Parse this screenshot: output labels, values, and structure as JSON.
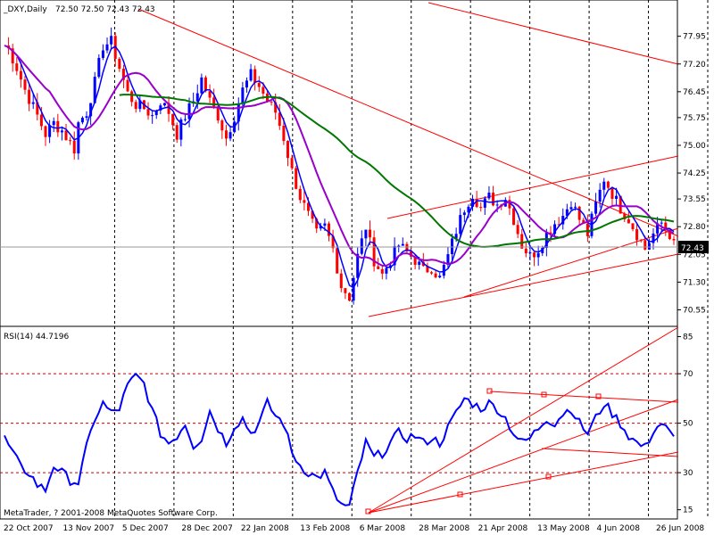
{
  "header": {
    "symbol": "_DXY,Daily",
    "ohlc": "72.50 72.50 72.43 72.43"
  },
  "price_panel": {
    "current_price": "72.43",
    "y_ticks": [
      "77.95",
      "77.20",
      "76.45",
      "75.75",
      "75.00",
      "74.25",
      "73.55",
      "72.80",
      "72.05",
      "71.30",
      "70.55"
    ]
  },
  "rsi_panel": {
    "title": "RSI(14) 44.7196",
    "y_ticks": [
      "85",
      "70",
      "50",
      "30",
      "15"
    ]
  },
  "x_ticks": [
    "22 Oct 2007",
    "13 Nov 2007",
    "5 Dec 2007",
    "28 Dec 2007",
    "22 Jan 2008",
    "13 Feb 2008",
    "6 Mar 2008",
    "28 Mar 2008",
    "21 Apr 2008",
    "13 May 2008",
    "4 Jun 2008",
    "26 Jun 2008"
  ],
  "copyright": "MetaTrader, ? 2001-2008 MetaQuotes Software Corp.",
  "colors": {
    "bull": "#0000ff",
    "bear": "#ff0000",
    "ma_fast": "#0000ff",
    "ma_mid": "#9900cc",
    "ma_slow": "#007700",
    "trendline": "#ff0000",
    "rsi": "#0000ff",
    "level_line": "#cc0000",
    "grid": "#000000"
  },
  "chart_data": [
    {
      "type": "candlestick",
      "title": "_DXY,Daily",
      "ylim": [
        70.2,
        78.4
      ],
      "x": [
        "22 Oct 2007",
        "13 Nov 2007",
        "5 Dec 2007",
        "28 Dec 2007",
        "22 Jan 2008",
        "13 Feb 2008",
        "6 Mar 2008",
        "28 Mar 2008",
        "21 Apr 2008",
        "13 May 2008",
        "4 Jun 2008",
        "26 Jun 2008"
      ],
      "close_path": [
        [
          0,
          77.7
        ],
        [
          1,
          77.6
        ],
        [
          3,
          77.1
        ],
        [
          5,
          76.5
        ],
        [
          8,
          75.8
        ],
        [
          10,
          75.3
        ],
        [
          12,
          75.6
        ],
        [
          14,
          75.4
        ],
        [
          17,
          74.9
        ],
        [
          18,
          75.6
        ],
        [
          20,
          75.9
        ],
        [
          22,
          76.7
        ],
        [
          24,
          77.7
        ],
        [
          26,
          77.8
        ],
        [
          28,
          77.1
        ],
        [
          30,
          76.4
        ],
        [
          32,
          76.1
        ],
        [
          34,
          76.0
        ],
        [
          36,
          75.8
        ],
        [
          38,
          76.2
        ],
        [
          40,
          75.9
        ],
        [
          42,
          75.3
        ],
        [
          44,
          75.8
        ],
        [
          46,
          76.2
        ],
        [
          48,
          76.8
        ],
        [
          50,
          76.2
        ],
        [
          52,
          75.8
        ],
        [
          54,
          75.2
        ],
        [
          56,
          75.8
        ],
        [
          58,
          76.5
        ],
        [
          60,
          76.9
        ],
        [
          62,
          76.6
        ],
        [
          64,
          76.2
        ],
        [
          66,
          75.9
        ],
        [
          68,
          75.2
        ],
        [
          70,
          74.3
        ],
        [
          72,
          73.6
        ],
        [
          74,
          73.1
        ],
        [
          76,
          72.6
        ],
        [
          78,
          72.8
        ],
        [
          80,
          72.2
        ],
        [
          82,
          71.2
        ],
        [
          84,
          70.9
        ],
        [
          86,
          72.0
        ],
        [
          88,
          72.8
        ],
        [
          90,
          71.9
        ],
        [
          92,
          71.5
        ],
        [
          94,
          71.9
        ],
        [
          96,
          72.3
        ],
        [
          98,
          72.1
        ],
        [
          100,
          71.9
        ],
        [
          102,
          71.6
        ],
        [
          104,
          71.7
        ],
        [
          106,
          71.4
        ],
        [
          108,
          72.0
        ],
        [
          110,
          72.7
        ],
        [
          112,
          73.3
        ],
        [
          114,
          73.7
        ],
        [
          116,
          73.3
        ],
        [
          118,
          73.6
        ],
        [
          120,
          73.4
        ],
        [
          122,
          73.6
        ],
        [
          124,
          73.0
        ],
        [
          126,
          72.3
        ],
        [
          128,
          72.0
        ],
        [
          130,
          72.2
        ],
        [
          132,
          72.6
        ],
        [
          134,
          72.9
        ],
        [
          136,
          73.1
        ],
        [
          138,
          73.5
        ],
        [
          140,
          73.0
        ],
        [
          142,
          72.6
        ],
        [
          144,
          73.4
        ],
        [
          146,
          74.1
        ],
        [
          148,
          73.7
        ],
        [
          150,
          73.3
        ],
        [
          152,
          73.0
        ],
        [
          154,
          72.6
        ],
        [
          156,
          72.2
        ],
        [
          158,
          72.6
        ],
        [
          160,
          72.9
        ],
        [
          162,
          72.6
        ],
        [
          163,
          72.43
        ]
      ],
      "moving_averages": [
        {
          "name": "MA fast",
          "color": "#0000ff"
        },
        {
          "name": "MA mid",
          "color": "#9900cc"
        },
        {
          "name": "MA slow",
          "color": "#007700"
        }
      ]
    },
    {
      "type": "line",
      "title": "RSI(14) 44.7196",
      "ylim": [
        12,
        87
      ],
      "levels": [
        70,
        50,
        30
      ],
      "series": [
        {
          "values": [
            [
              0,
              44
            ],
            [
              2,
              38
            ],
            [
              4,
              32
            ],
            [
              6,
              30
            ],
            [
              8,
              25
            ],
            [
              10,
              23
            ],
            [
              12,
              33
            ],
            [
              14,
              30
            ],
            [
              16,
              27
            ],
            [
              18,
              26
            ],
            [
              20,
              40
            ],
            [
              22,
              52
            ],
            [
              24,
              58
            ],
            [
              26,
              54
            ],
            [
              28,
              56
            ],
            [
              30,
              65
            ],
            [
              32,
              69
            ],
            [
              34,
              66
            ],
            [
              36,
              55
            ],
            [
              38,
              46
            ],
            [
              40,
              42
            ],
            [
              42,
              45
            ],
            [
              44,
              50
            ],
            [
              46,
              41
            ],
            [
              48,
              44
            ],
            [
              50,
              55
            ],
            [
              52,
              48
            ],
            [
              54,
              42
            ],
            [
              56,
              49
            ],
            [
              58,
              52
            ],
            [
              60,
              46
            ],
            [
              62,
              50
            ],
            [
              64,
              58
            ],
            [
              66,
              53
            ],
            [
              68,
              50
            ],
            [
              70,
              38
            ],
            [
              72,
              33
            ],
            [
              74,
              30
            ],
            [
              76,
              28
            ],
            [
              78,
              30
            ],
            [
              80,
              22
            ],
            [
              82,
              17
            ],
            [
              84,
              16
            ],
            [
              86,
              30
            ],
            [
              88,
              42
            ],
            [
              90,
              36
            ],
            [
              92,
              38
            ],
            [
              94,
              42
            ],
            [
              96,
              46
            ],
            [
              98,
              44
            ],
            [
              100,
              45
            ],
            [
              102,
              42
            ],
            [
              104,
              44
            ],
            [
              106,
              42
            ],
            [
              108,
              48
            ],
            [
              110,
              54
            ],
            [
              112,
              60
            ],
            [
              114,
              58
            ],
            [
              116,
              56
            ],
            [
              118,
              58
            ],
            [
              120,
              56
            ],
            [
              122,
              52
            ],
            [
              124,
              46
            ],
            [
              126,
              42
            ],
            [
              128,
              44
            ],
            [
              130,
              48
            ],
            [
              132,
              52
            ],
            [
              134,
              50
            ],
            [
              136,
              54
            ],
            [
              138,
              56
            ],
            [
              140,
              50
            ],
            [
              142,
              46
            ],
            [
              144,
              52
            ],
            [
              146,
              58
            ],
            [
              148,
              54
            ],
            [
              150,
              50
            ],
            [
              152,
              45
            ],
            [
              154,
              42
            ],
            [
              156,
              40
            ],
            [
              158,
              47
            ],
            [
              160,
              50
            ],
            [
              162,
              46
            ],
            [
              163,
              44.7
            ]
          ]
        }
      ]
    }
  ]
}
